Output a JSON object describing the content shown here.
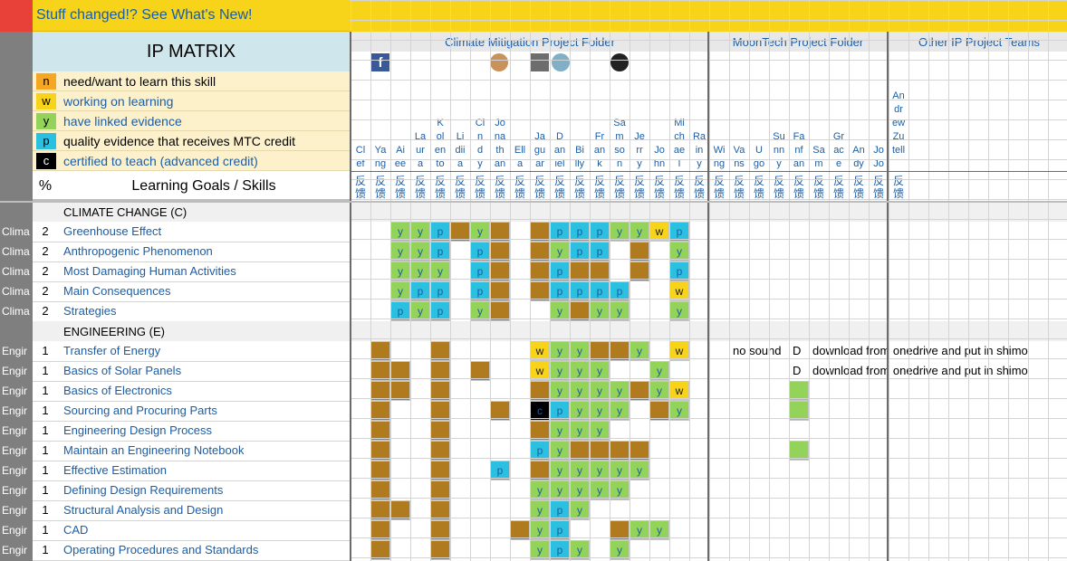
{
  "banner": {
    "text": "Stuff changed!? See What's New!"
  },
  "title": "IP MATRIX",
  "legend": [
    {
      "code": "n",
      "text": "need/want to learn this skill",
      "color": "#f5a623",
      "text_color": "#000000"
    },
    {
      "code": "w",
      "text": "working on learning",
      "color": "#f7d31a",
      "text_color": "#1a5ea8"
    },
    {
      "code": "y",
      "text": "have linked evidence",
      "color": "#93d35a",
      "text_color": "#1a5ea8"
    },
    {
      "code": "p",
      "text": "quality evidence that receives MTC credit",
      "color": "#2bbfe0",
      "text_color": "#000000"
    },
    {
      "code": "c",
      "text": "certified to teach (advanced credit)",
      "color": "#000000",
      "text_color": "#1a5ea8"
    }
  ],
  "header": {
    "pct": "%",
    "goals": "Learning Goals / Skills"
  },
  "folders": {
    "climate": "Climate Mitigation Project Folder",
    "moontech": "MoonTech Project Folder",
    "other": "Other IP Project Teams"
  },
  "feedback_label": "反馈",
  "people": [
    {
      "lines": [
        "Cl",
        "ef"
      ]
    },
    {
      "lines": [
        "Ya",
        "ng"
      ]
    },
    {
      "lines": [
        "Ai",
        "ee"
      ]
    },
    {
      "lines": [
        "La",
        "ur",
        "a"
      ]
    },
    {
      "lines": [
        "K",
        "ol",
        "en",
        "to"
      ]
    },
    {
      "lines": [
        "Li",
        "dii",
        "a"
      ]
    },
    {
      "lines": [
        "Ci",
        "n",
        "d",
        "y"
      ]
    },
    {
      "lines": [
        "Jo",
        "na",
        "th",
        "an"
      ]
    },
    {
      "lines": [
        "Ell",
        "a"
      ]
    },
    {
      "lines": [
        "Ja",
        "gu",
        "ar"
      ]
    },
    {
      "lines": [
        "D",
        "an",
        "iel"
      ]
    },
    {
      "lines": [
        "Bi",
        "lly"
      ]
    },
    {
      "lines": [
        "Fr",
        "an",
        "k"
      ]
    },
    {
      "lines": [
        "Sa",
        "m",
        "so",
        "n"
      ]
    },
    {
      "lines": [
        "Je",
        "rr",
        "y"
      ]
    },
    {
      "lines": [
        "Jo",
        "hn"
      ]
    },
    {
      "lines": [
        "Mi",
        "ch",
        "ae",
        "l"
      ]
    },
    {
      "lines": [
        "Ra",
        "in",
        "y"
      ]
    },
    {
      "lines": [
        "Wi",
        "ng"
      ]
    },
    {
      "lines": [
        "Va",
        "ns"
      ]
    },
    {
      "lines": [
        "U",
        "go"
      ]
    },
    {
      "lines": [
        "Su",
        "nn",
        "y"
      ]
    },
    {
      "lines": [
        "Fa",
        "nf",
        "an"
      ]
    },
    {
      "lines": [
        "Sa",
        "m"
      ]
    },
    {
      "lines": [
        "Gr",
        "ac",
        "e"
      ]
    },
    {
      "lines": [
        "An",
        "dy"
      ]
    },
    {
      "lines": [
        "Jo",
        "Jo"
      ]
    },
    {
      "lines": [
        "An",
        "dr",
        "ew",
        "",
        "Zu",
        "tell"
      ]
    }
  ],
  "sections": [
    {
      "label": "CLIMATE CHANGE (C)"
    },
    {
      "label": "ENGINEERING (E)"
    }
  ],
  "rows": [
    {
      "tag": "Clima",
      "num": "2",
      "skill": "Greenhouse Effect",
      "cells": [
        "",
        "",
        "y",
        "y",
        "p",
        "b",
        "y",
        "b",
        "",
        "b",
        "p",
        "p",
        "p",
        "y",
        "y",
        "w",
        "p",
        "",
        "",
        "",
        "",
        "",
        "",
        "",
        "",
        "",
        "",
        ""
      ]
    },
    {
      "tag": "Clima",
      "num": "2",
      "skill": "Anthropogenic Phenomenon",
      "cells": [
        "",
        "",
        "y",
        "y",
        "p",
        "",
        "p",
        "b",
        "",
        "b",
        "y",
        "p",
        "p",
        "",
        "b",
        "",
        "y",
        "",
        "",
        "",
        "",
        "",
        "",
        "",
        "",
        "",
        "",
        ""
      ]
    },
    {
      "tag": "Clima",
      "num": "2",
      "skill": "Most Damaging Human Activities",
      "cells": [
        "",
        "",
        "y",
        "y",
        "y",
        "",
        "p",
        "b",
        "",
        "b",
        "p",
        "b",
        "b",
        "",
        "b",
        "",
        "p",
        "",
        "",
        "",
        "",
        "",
        "",
        "",
        "",
        "",
        "",
        ""
      ]
    },
    {
      "tag": "Clima",
      "num": "2",
      "skill": "Main Consequences",
      "cells": [
        "",
        "",
        "y",
        "p",
        "p",
        "",
        "p",
        "b",
        "",
        "b",
        "p",
        "p",
        "p",
        "p",
        "",
        "",
        "w",
        "",
        "",
        "",
        "",
        "",
        "",
        "",
        "",
        "",
        "",
        ""
      ]
    },
    {
      "tag": "Clima",
      "num": "2",
      "skill": "Strategies",
      "cells": [
        "",
        "",
        "p",
        "y",
        "p",
        "",
        "y",
        "b",
        "",
        "",
        "y",
        "b",
        "y",
        "y",
        "",
        "",
        "y",
        "",
        "",
        "",
        "",
        "",
        "",
        "",
        "",
        "",
        "",
        ""
      ]
    },
    {
      "tag": "Engir",
      "num": "1",
      "skill": "Transfer of Energy",
      "cells": [
        "",
        "b",
        "",
        "",
        "b",
        "",
        "",
        "",
        "",
        "w",
        "y",
        "y",
        "b",
        "b",
        "y",
        "",
        "w",
        "",
        "",
        "",
        "",
        "",
        "",
        "",
        "",
        "",
        "",
        ""
      ]
    },
    {
      "tag": "Engir",
      "num": "1",
      "skill": "Basics of Solar Panels",
      "cells": [
        "",
        "b",
        "b",
        "",
        "b",
        "",
        "b",
        "",
        "",
        "w",
        "y",
        "y",
        "y",
        "",
        "",
        "y",
        "",
        "",
        "",
        "",
        "",
        "",
        "",
        "",
        "",
        "",
        "",
        ""
      ]
    },
    {
      "tag": "Engir",
      "num": "1",
      "skill": "Basics of Electronics",
      "cells": [
        "",
        "b",
        "b",
        "",
        "b",
        "",
        "",
        "",
        "",
        "b",
        "y",
        "y",
        "y",
        "y",
        "b",
        "y",
        "w",
        "",
        "",
        "",
        "",
        "",
        "",
        "",
        "",
        "",
        "",
        ""
      ]
    },
    {
      "tag": "Engir",
      "num": "1",
      "skill": "Sourcing and Procuring Parts",
      "cells": [
        "",
        "b",
        "",
        "",
        "b",
        "",
        "",
        "b",
        "",
        "c",
        "p",
        "y",
        "y",
        "y",
        "",
        "b",
        "y",
        "",
        "",
        "",
        "",
        "",
        "",
        "",
        "",
        "",
        "",
        ""
      ]
    },
    {
      "tag": "Engir",
      "num": "1",
      "skill": "Engineering Design Process",
      "cells": [
        "",
        "b",
        "",
        "",
        "b",
        "",
        "",
        "",
        "",
        "b",
        "y",
        "y",
        "y",
        "",
        "",
        "",
        "",
        "",
        "",
        "",
        "",
        "",
        "",
        "",
        "",
        "",
        "",
        ""
      ]
    },
    {
      "tag": "Engir",
      "num": "1",
      "skill": "Maintain an Engineering Notebook",
      "cells": [
        "",
        "b",
        "",
        "",
        "b",
        "",
        "",
        "",
        "",
        "p",
        "y",
        "b",
        "b",
        "b",
        "b",
        "",
        "",
        "",
        "",
        "",
        "",
        "",
        "",
        "",
        "",
        "",
        "",
        ""
      ]
    },
    {
      "tag": "Engir",
      "num": "1",
      "skill": "Effective Estimation",
      "cells": [
        "",
        "b",
        "",
        "",
        "b",
        "",
        "",
        "p",
        "",
        "b",
        "y",
        "y",
        "y",
        "y",
        "y",
        "",
        "",
        "",
        "",
        "",
        "",
        "",
        "",
        "",
        "",
        "",
        "",
        ""
      ]
    },
    {
      "tag": "Engir",
      "num": "1",
      "skill": "Defining Design Requirements",
      "cells": [
        "",
        "b",
        "",
        "",
        "b",
        "",
        "",
        "",
        "",
        "y",
        "y",
        "y",
        "y",
        "y",
        "",
        "",
        "",
        "",
        "",
        "",
        "",
        "",
        "",
        "",
        "",
        "",
        "",
        ""
      ]
    },
    {
      "tag": "Engir",
      "num": "1",
      "skill": "Structural Analysis and Design",
      "cells": [
        "",
        "b",
        "b",
        "",
        "b",
        "",
        "",
        "",
        "",
        "y",
        "p",
        "y",
        "",
        "",
        "",
        "",
        "",
        "",
        "",
        "",
        "",
        "",
        "",
        "",
        "",
        "",
        "",
        ""
      ]
    },
    {
      "tag": "Engir",
      "num": "1",
      "skill": "CAD",
      "cells": [
        "",
        "b",
        "",
        "",
        "b",
        "",
        "",
        "",
        "b",
        "y",
        "p",
        "",
        "",
        "b",
        "y",
        "y",
        "",
        "",
        "",
        "",
        "",
        "",
        "",
        "",
        "",
        "",
        "",
        ""
      ]
    },
    {
      "tag": "Engir",
      "num": "1",
      "skill": "Operating Procedures and Standards",
      "cells": [
        "",
        "b",
        "",
        "",
        "b",
        "",
        "",
        "",
        "",
        "y",
        "p",
        "y",
        "",
        "y",
        "",
        "",
        "",
        "",
        "",
        "",
        "",
        "",
        "",
        "",
        "",
        "",
        "",
        ""
      ]
    }
  ],
  "notes": [
    {
      "row": 5,
      "moontech": "no sound",
      "mark": "D",
      "text": "download from onedrive and put in shimo"
    },
    {
      "row": 6,
      "moontech": "",
      "mark": "D",
      "text": "download from onedrive and put in shimo"
    }
  ],
  "colors": {
    "gray": "#7f7f7f",
    "yellow_bar": "#f7d31a",
    "teal_header": "#cfe7ec",
    "cream": "#fdf1cc",
    "brown": "#b07a1f",
    "green": "#93d35a",
    "blue": "#2bbfe0",
    "gold": "#f7d31a",
    "black": "#000000"
  }
}
